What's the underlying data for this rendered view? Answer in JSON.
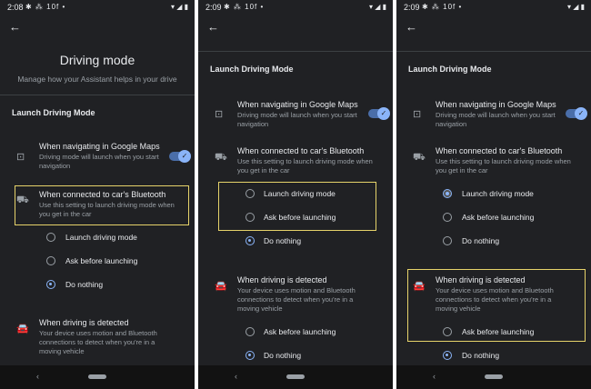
{
  "screens": [
    {
      "time": "2:08",
      "title": "Driving mode",
      "subtitle": "Manage how your Assistant helps in your drive",
      "section": "Launch Driving Mode",
      "maps": {
        "title": "When navigating in Google Maps",
        "desc": "Driving mode will launch when you start navigation"
      },
      "bluetooth": {
        "title": "When connected to car's Bluetooth",
        "desc": "Use this setting to launch driving mode when you get in the car"
      },
      "options": [
        "Launch driving mode",
        "Ask before launching",
        "Do nothing"
      ],
      "detected": {
        "title": "When driving is detected",
        "desc": "Your device uses motion and Bluetooth connections to detect when you're in a moving vehicle"
      }
    },
    {
      "time": "2:09",
      "section": "Launch Driving Mode",
      "maps": {
        "title": "When navigating in Google Maps",
        "desc": "Driving mode will launch when you start navigation"
      },
      "bluetooth": {
        "title": "When connected to car's Bluetooth",
        "desc": "Use this setting to launch driving mode when you get in the car"
      },
      "options": [
        "Launch driving mode",
        "Ask before launching",
        "Do nothing"
      ],
      "detected": {
        "title": "When driving is detected",
        "desc": "Your device uses motion and Bluetooth connections to detect when you're in a moving vehicle"
      },
      "detected_options": [
        "Ask before launching",
        "Do nothing"
      ]
    },
    {
      "time": "2:09",
      "section": "Launch Driving Mode",
      "maps": {
        "title": "When navigating in Google Maps",
        "desc": "Driving mode will launch when you start navigation"
      },
      "bluetooth": {
        "title": "When connected to car's Bluetooth",
        "desc": "Use this setting to launch driving mode when you get in the car"
      },
      "options": [
        "Launch driving mode",
        "Ask before launching",
        "Do nothing"
      ],
      "detected": {
        "title": "When driving is detected",
        "desc": "Your device uses motion and Bluetooth connections to detect when you're in a moving vehicle"
      },
      "detected_options": [
        "Ask before launching",
        "Do nothing"
      ]
    }
  ],
  "status_icons_left": "✱ ⁂ 10f •",
  "status_icons_right": "▾ ◢ ▮",
  "colors": {
    "background": "#202124",
    "accent": "#8ab4f8",
    "highlight": "#e6d36a"
  }
}
